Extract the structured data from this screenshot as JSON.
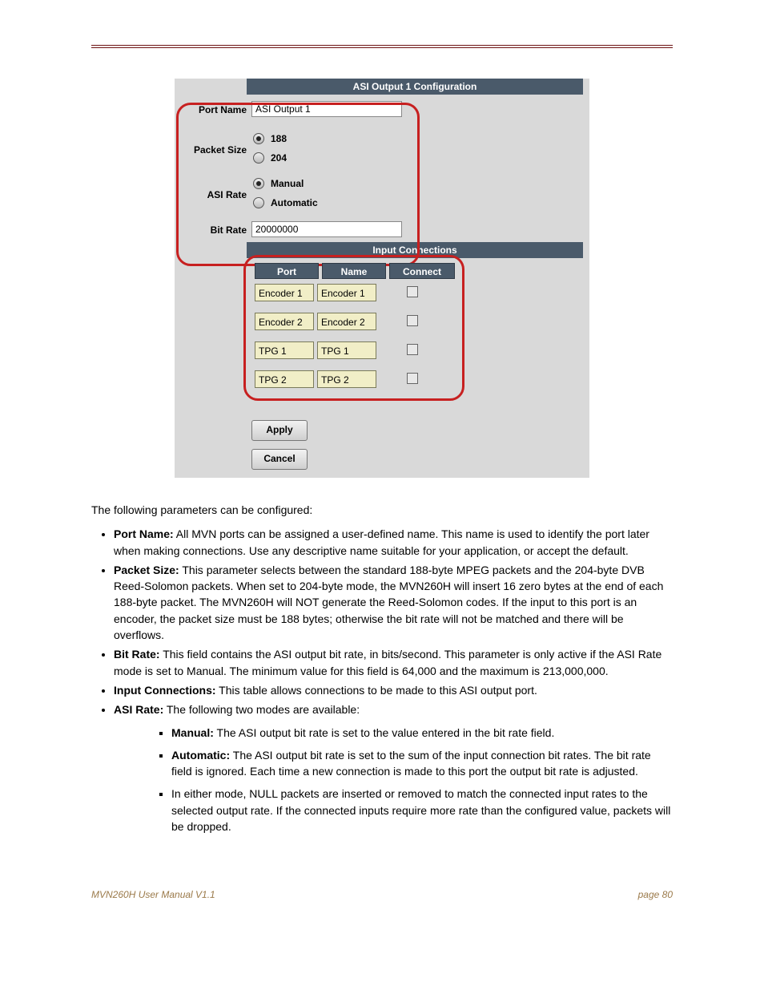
{
  "config": {
    "header": "ASI Output 1 Configuration",
    "fields": {
      "port_name": {
        "label": "Port Name",
        "value": "ASI Output 1"
      },
      "packet_size": {
        "label": "Packet Size",
        "options": [
          {
            "label": "188",
            "selected": true
          },
          {
            "label": "204",
            "selected": false
          }
        ]
      },
      "asi_rate": {
        "label": "ASI Rate",
        "options": [
          {
            "label": "Manual",
            "selected": true
          },
          {
            "label": "Automatic",
            "selected": false
          }
        ]
      },
      "bit_rate": {
        "label": "Bit Rate",
        "value": "20000000"
      }
    },
    "input_connections": {
      "header": "Input Connections",
      "columns": {
        "port": "Port",
        "name": "Name",
        "connect": "Connect"
      },
      "rows": [
        {
          "port": "Encoder 1",
          "name": "Encoder 1",
          "connected": false
        },
        {
          "port": "Encoder 2",
          "name": "Encoder 2",
          "connected": false
        },
        {
          "port": "TPG 1",
          "name": "TPG 1",
          "connected": false
        },
        {
          "port": "TPG 2",
          "name": "TPG 2",
          "connected": false
        }
      ]
    },
    "buttons": {
      "apply": "Apply",
      "cancel": "Cancel"
    }
  },
  "doc": {
    "intro": "The following parameters can be configured:",
    "b1_lead": "Port Name:",
    "b1_rest": " All MVN ports can be assigned a user-defined name. This name is used to identify the port later when making connections. Use any descriptive name suitable for your application, or accept the default.",
    "b2_lead": "Packet Size:",
    "b2_rest": " This parameter selects between the standard 188-byte MPEG packets and the 204-byte DVB Reed-Solomon packets. When set to 204-byte mode, the MVN260H will insert 16 zero bytes at the end of each 188-byte packet. The MVN260H will NOT generate the Reed-Solomon codes. If the input to this port is an encoder, the packet size must be 188 bytes; otherwise the bit rate will not be matched and there will be overflows.",
    "b3_lead": "Bit Rate:",
    "b3_rest": " This field contains the ASI output bit rate, in bits/second. This parameter is only active if the ASI Rate mode is set to Manual. The minimum value for this field is 64,000 and the maximum is 213,000,000.",
    "b4_lead": "Input Connections:",
    "b4_rest": " This table allows connections to be made to this ASI output port.",
    "b5_lead": "ASI Rate:",
    "b5_rest": " The following two modes are available:",
    "s1_lead": "Manual:",
    "s1_rest": " The ASI output bit rate is set to the value entered in the bit rate field.",
    "s2_lead": "Automatic:",
    "s2_rest": " The ASI output bit rate is set to the sum of the input connection bit rates. The bit rate field is ignored. Each time a new connection is made to this port the output bit rate is adjusted.",
    "s3": "In either mode, NULL packets are inserted or removed to match the connected input rates to the selected output rate. If the connected inputs require more rate than the configured value, packets will be dropped.",
    "footer_left": "MVN260H User Manual V1.1",
    "footer_right": "page 80"
  }
}
